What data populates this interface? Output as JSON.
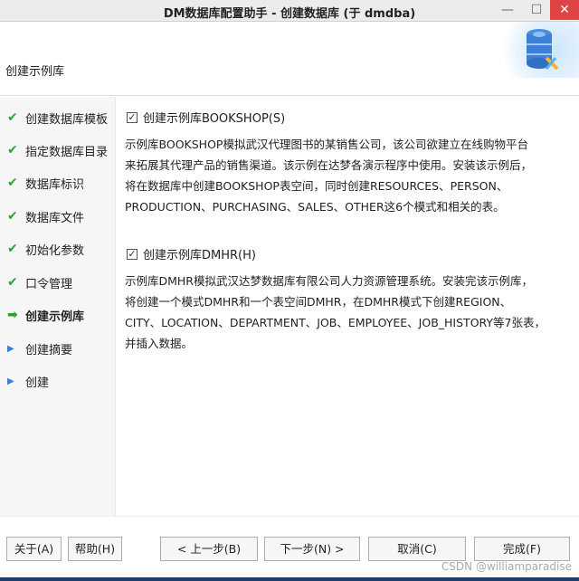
{
  "window": {
    "title": "DM数据库配置助手 - 创建数据库 (于 dmdba)",
    "minimize": "—",
    "maximize": "☐",
    "close": "✕"
  },
  "header": {
    "title": "创建示例库"
  },
  "sidebar": {
    "items": [
      {
        "label": "创建数据库模板",
        "state": "done"
      },
      {
        "label": "指定数据库目录",
        "state": "done"
      },
      {
        "label": "数据库标识",
        "state": "done"
      },
      {
        "label": "数据库文件",
        "state": "done"
      },
      {
        "label": "初始化参数",
        "state": "done"
      },
      {
        "label": "口令管理",
        "state": "done"
      },
      {
        "label": "创建示例库",
        "state": "current"
      },
      {
        "label": "创建摘要",
        "state": "pending"
      },
      {
        "label": "创建",
        "state": "pending"
      }
    ]
  },
  "main": {
    "bookshop": {
      "label": "创建示例库BOOKSHOP(S)",
      "checked": true,
      "lines": [
        "示例库BOOKSHOP模拟武汉代理图书的某销售公司，该公司欲建立在线购物平台",
        "来拓展其代理产品的销售渠道。该示例在达梦各演示程序中使用。安装该示例后，",
        "将在数据库中创建BOOKSHOP表空间，同时创建RESOURCES、PERSON、",
        "PRODUCTION、PURCHASING、SALES、OTHER这6个模式和相关的表。"
      ]
    },
    "dmhr": {
      "label": "创建示例库DMHR(H)",
      "checked": true,
      "lines": [
        "示例库DMHR模拟武汉达梦数据库有限公司人力资源管理系统。安装完该示例库，",
        "将创建一个模式DMHR和一个表空间DMHR，在DMHR模式下创建REGION、",
        "CITY、LOCATION、DEPARTMENT、JOB、EMPLOYEE、JOB_HISTORY等7张表，",
        "并插入数据。"
      ]
    }
  },
  "footer": {
    "about": "关于(A)",
    "help": "帮助(H)",
    "prev": "< 上一步(B)",
    "next": "下一步(N) >",
    "cancel": "取消(C)",
    "finish": "完成(F)",
    "watermark": "CSDN @williamparadise"
  }
}
